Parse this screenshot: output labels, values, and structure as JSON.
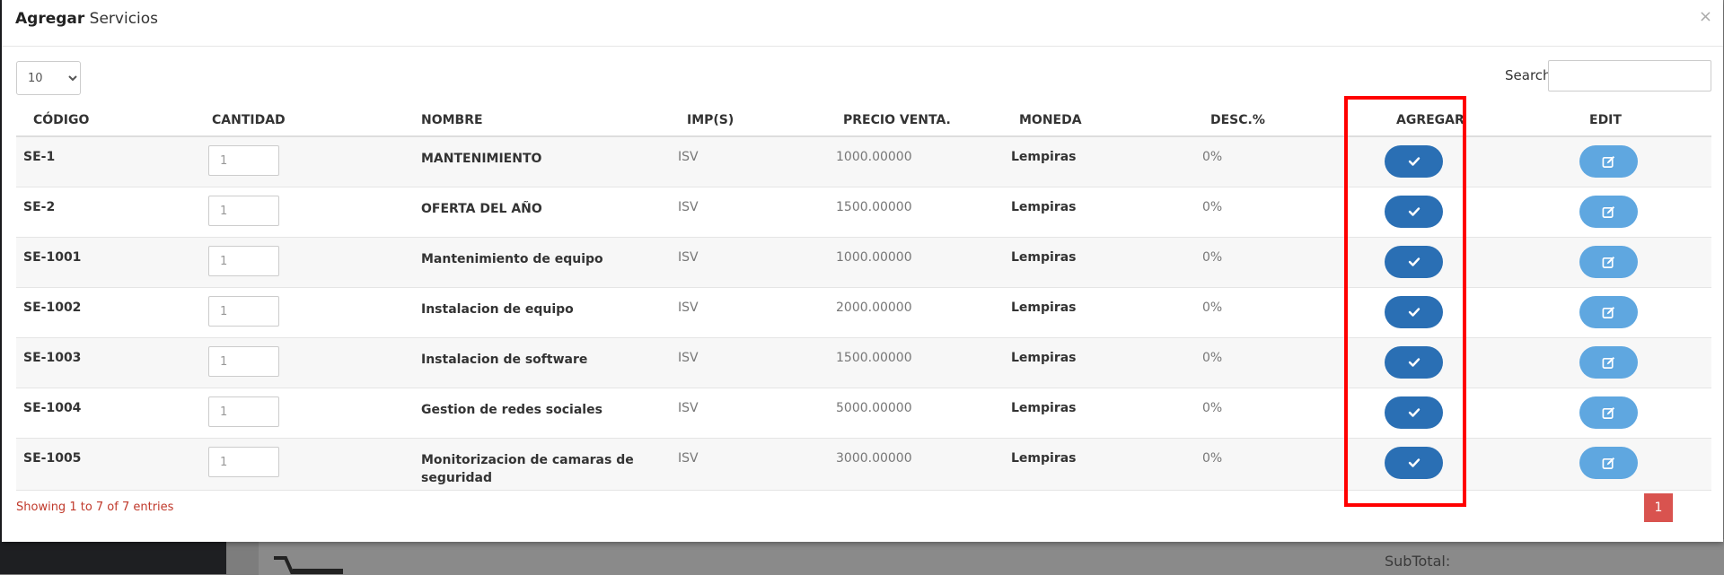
{
  "background": {
    "subtotal_label": "SubTotal:"
  },
  "modal": {
    "title_bold": "Agregar",
    "title_rest": " Servicios",
    "close": "×"
  },
  "controls": {
    "page_length": "10",
    "search_label": "Search:",
    "search_value": ""
  },
  "table": {
    "headers": [
      "CÓDIGO",
      "CANTIDAD",
      "NOMBRE",
      "IMP(S)",
      "PRECIO VENTA.",
      "MONEDA",
      "DESC.%",
      "AGREGAR",
      "EDIT"
    ],
    "rows": [
      {
        "code": "SE-1",
        "qty": "1",
        "name": "MANTENIMIENTO",
        "tax": "ISV",
        "price": "1000.00000",
        "currency": "Lempiras",
        "discount": "0%"
      },
      {
        "code": "SE-2",
        "qty": "1",
        "name": "OFERTA DEL AÑO",
        "tax": "ISV",
        "price": "1500.00000",
        "currency": "Lempiras",
        "discount": "0%"
      },
      {
        "code": "SE-1001",
        "qty": "1",
        "name": "Mantenimiento de equipo",
        "tax": "ISV",
        "price": "1000.00000",
        "currency": "Lempiras",
        "discount": "0%"
      },
      {
        "code": "SE-1002",
        "qty": "1",
        "name": "Instalacion de equipo",
        "tax": "ISV",
        "price": "2000.00000",
        "currency": "Lempiras",
        "discount": "0%"
      },
      {
        "code": "SE-1003",
        "qty": "1",
        "name": "Instalacion de software",
        "tax": "ISV",
        "price": "1500.00000",
        "currency": "Lempiras",
        "discount": "0%"
      },
      {
        "code": "SE-1004",
        "qty": "1",
        "name": "Gestion de redes sociales",
        "tax": "ISV",
        "price": "5000.00000",
        "currency": "Lempiras",
        "discount": "0%"
      },
      {
        "code": "SE-1005",
        "qty": "1",
        "name": "Monitorizacion de camaras de seguridad",
        "tax": "ISV",
        "price": "3000.00000",
        "currency": "Lempiras",
        "discount": "0%"
      }
    ]
  },
  "footer": {
    "info": "Showing 1 to 7 of 7 entries",
    "page": "1"
  },
  "icons": {
    "add": "check-icon",
    "edit": "edit-icon"
  },
  "colors": {
    "add_button": "#2a6fb4",
    "edit_button": "#5fa7e0",
    "highlight": "#ff0000",
    "pagination": "#d9534f"
  }
}
